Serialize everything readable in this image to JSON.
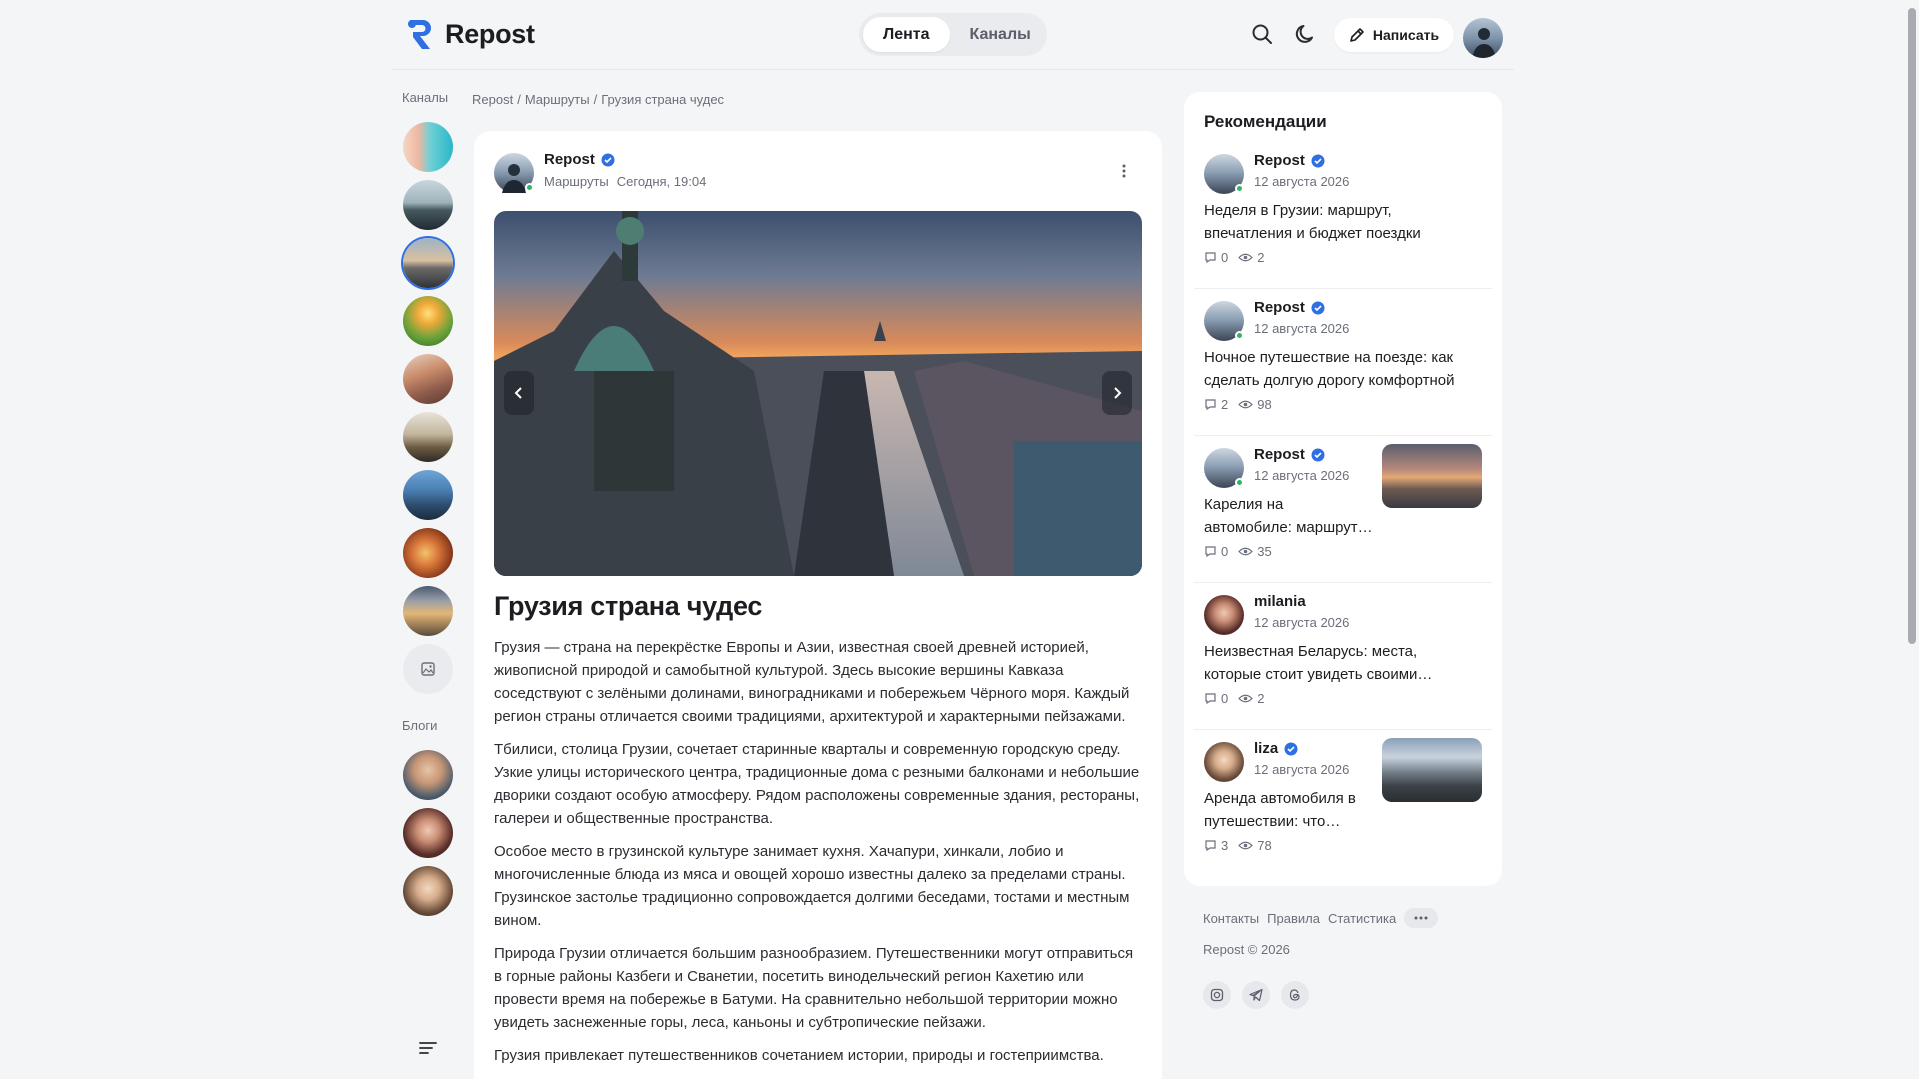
{
  "header": {
    "logo_text": "Repost",
    "tabs": [
      {
        "label": "Лента",
        "active": true
      },
      {
        "label": "Каналы",
        "active": false
      }
    ],
    "write_label": "Написать",
    "accent_color": "#2f6fe4"
  },
  "rail": {
    "channels_title": "Каналы",
    "blogs_title": "Блоги"
  },
  "breadcrumb": {
    "items": [
      "Repost",
      "/",
      "Маршруты",
      "/",
      "Грузия страна чудес"
    ]
  },
  "post": {
    "author": "Repost",
    "category": "Маршруты",
    "time": "Сегодня, 19:04",
    "title": "Грузия страна чудес",
    "paragraphs": [
      "Грузия — страна на перекрёстке Европы и Азии, известная своей древней историей, живописной природой и самобытной культурой. Здесь высокие вершины Кавказа соседствуют с зелёными долинами, виноградниками и побережьем Чёрного моря. Каждый регион страны отличается своими традициями, архитектурой и характерными пейзажами.",
      "Тбилиси, столица Грузии, сочетает старинные кварталы и современную городскую среду. Узкие улицы исторического центра, традиционные дома с резными балконами и небольшие дворики создают особую атмосферу. Рядом расположены современные здания, рестораны, галереи и общественные пространства.",
      "Особое место в грузинской культуре занимает кухня. Хачапури, хинкали, лобио и многочисленные блюда из мяса и овощей хорошо известны далеко за пределами страны. Грузинское застолье традиционно сопровождается долгими беседами, тостами и местным вином.",
      "Природа Грузии отличается большим разнообразием. Путешественники могут отправиться в горные районы Казбеги и Сванетии, посетить винодельческий регион Кахетию или провести время на побережье в Батуми. На сравнительно небольшой территории можно увидеть заснеженные горы, леса, каньоны и субтропические пейзажи.",
      "Грузия привлекает путешественников сочетанием истории, природы и гостеприимства."
    ]
  },
  "recs": {
    "title": "Рекомендации",
    "items": [
      {
        "author": "Repost",
        "date": "12 августа 2026",
        "line1": "Неделя в Грузии: маршрут,",
        "line2": "впечатления и бюджет поездки",
        "comments": "0",
        "views": "2"
      },
      {
        "author": "Repost",
        "date": "12 августа 2026",
        "line1": "Ночное путешествие на поезде: как",
        "line2": "сделать долгую дорогу комфортной",
        "comments": "2",
        "views": "98"
      },
      {
        "author": "Repost",
        "date": "12 августа 2026",
        "line1": "Карелия на",
        "line2": "автомобиле: маршрут…",
        "comments": "0",
        "views": "35"
      },
      {
        "author": "milania",
        "date": "12 августа 2026",
        "line1": "Неизвестная Беларусь: места,",
        "line2": "которые стоит увидеть своими…",
        "comments": "0",
        "views": "2"
      },
      {
        "author": "liza",
        "date": "12 августа 2026",
        "line1": "Аренда автомобиля в",
        "line2": "путешествии: что…",
        "comments": "3",
        "views": "78"
      }
    ]
  },
  "footer": {
    "links": [
      "Контакты",
      "Правила",
      "Статистика"
    ],
    "copyright": "Repost © 2026"
  }
}
